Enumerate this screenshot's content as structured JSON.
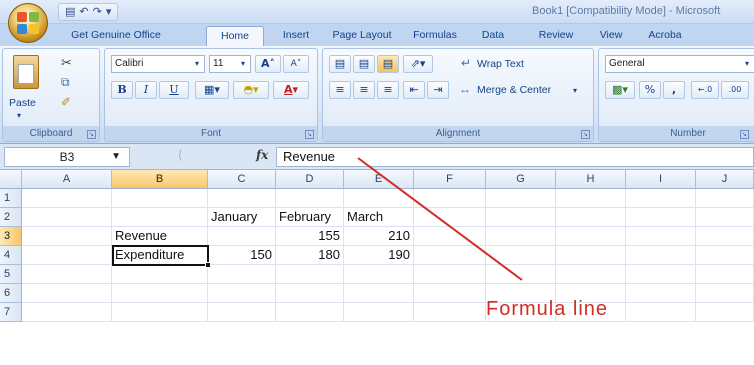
{
  "titlebar": {
    "document_title": "Book1 [Compatibility Mode] - Microsoft",
    "qat": {
      "save_icon": "save-icon",
      "undo": "↶",
      "redo": "↷",
      "more": "▾"
    }
  },
  "tabs": [
    {
      "label": "Get Genuine Office"
    },
    {
      "label": "Home"
    },
    {
      "label": "Insert"
    },
    {
      "label": "Page Layout"
    },
    {
      "label": "Formulas"
    },
    {
      "label": "Data"
    },
    {
      "label": "Review"
    },
    {
      "label": "View"
    },
    {
      "label": "Acroba"
    }
  ],
  "ribbon": {
    "clipboard": {
      "label": "Clipboard",
      "paste_label": "Paste"
    },
    "font": {
      "label": "Font",
      "font_name": "Calibri",
      "font_size": "11",
      "grow": "A˄",
      "shrink": "A˅",
      "bold": "B",
      "italic": "I",
      "underline": "U",
      "font_color_glyph": "A"
    },
    "alignment": {
      "label": "Alignment",
      "wrap_text": "Wrap Text",
      "merge_center": "Merge & Center"
    },
    "number": {
      "label": "Number",
      "format": "General",
      "percent": "%",
      "comma": ",",
      "increase_decimal": "⁰⁰.0",
      "decrease_decimal": ".00"
    }
  },
  "formula_bar": {
    "name_box": "B3",
    "fx": "fx",
    "value": "Revenue"
  },
  "grid": {
    "columns": [
      "A",
      "B",
      "C",
      "D",
      "E",
      "F",
      "G",
      "H",
      "I",
      "J"
    ],
    "rows": [
      "1",
      "2",
      "3",
      "4",
      "5",
      "6",
      "7"
    ],
    "selected_column": "B",
    "selected_row": "3",
    "cells": {
      "C2": "January",
      "D2": "February",
      "E2": "March",
      "B3": "Revenue",
      "D3": "155",
      "E3": "210",
      "B4": "Expenditure",
      "C4": "150",
      "D4": "180",
      "E4": "190"
    }
  },
  "annotation": {
    "text": "Formula line",
    "color": "#d22d22"
  }
}
